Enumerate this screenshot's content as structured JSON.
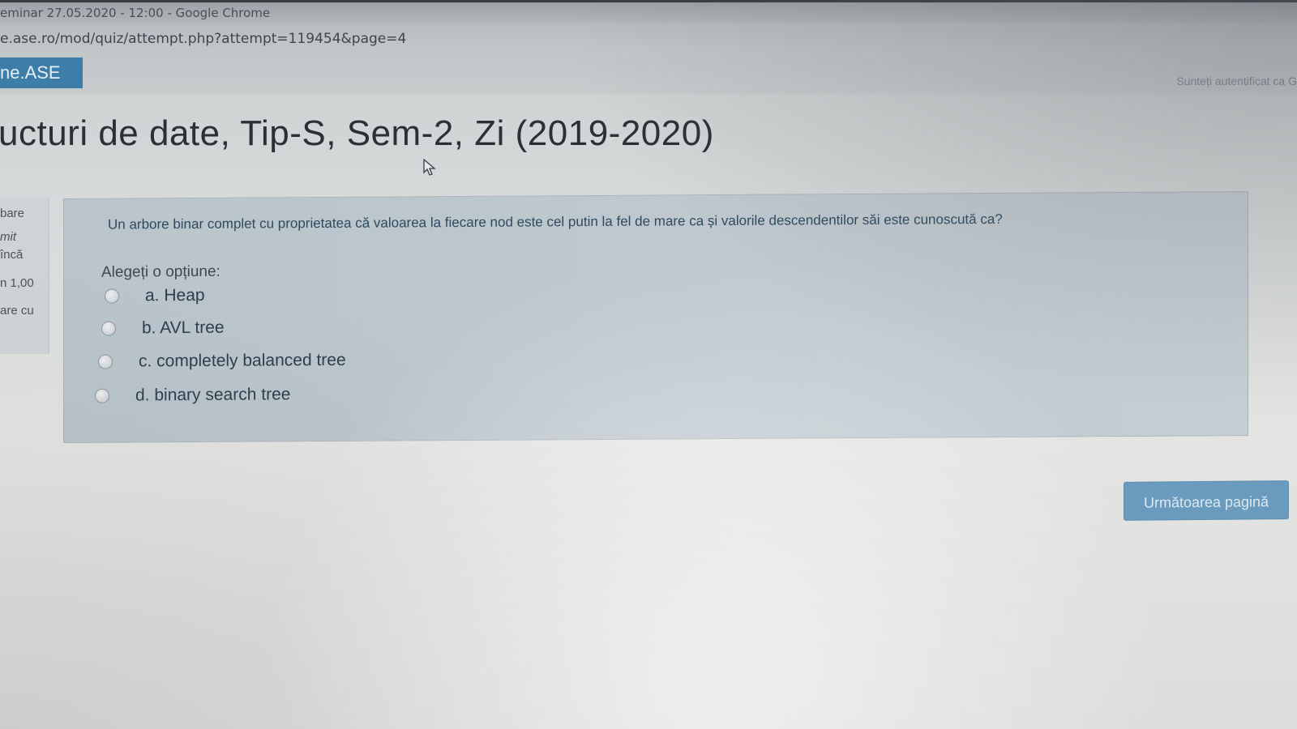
{
  "browser": {
    "window_title": "eminar 27.05.2020 - 12:00 - Google Chrome",
    "url": "e.ase.ro/mod/quiz/attempt.php?attempt=119454&page=4"
  },
  "navbar": {
    "brand": "ne.ASE",
    "user_info": "Sunteți autentificat ca G"
  },
  "course": {
    "title": "ucturi de date, Tip-S, Sem-2, Zi (2019-2020)"
  },
  "question_info": {
    "lines": [
      "bare",
      "mit",
      "încă",
      "n 1,00",
      "are cu"
    ]
  },
  "question": {
    "text": "Un arbore binar complet cu proprietatea că valoarea la fiecare nod este cel putin la fel de mare ca și valorile descendentilor săi este cunoscută ca?",
    "prompt": "Alegeți o opțiune:",
    "options": [
      {
        "label": "a. Heap"
      },
      {
        "label": "b. AVL tree"
      },
      {
        "label": "c. completely balanced tree"
      },
      {
        "label": "d. binary search tree"
      }
    ]
  },
  "actions": {
    "next_page": "Următoarea pagină"
  },
  "icons": {
    "cursor": "mouse-pointer-icon",
    "radio": "radio-button-icon"
  },
  "colors": {
    "brand_bg": "#3d7ea9",
    "button_bg": "#6a9bbf",
    "question_bg": "#bfc9cf"
  }
}
